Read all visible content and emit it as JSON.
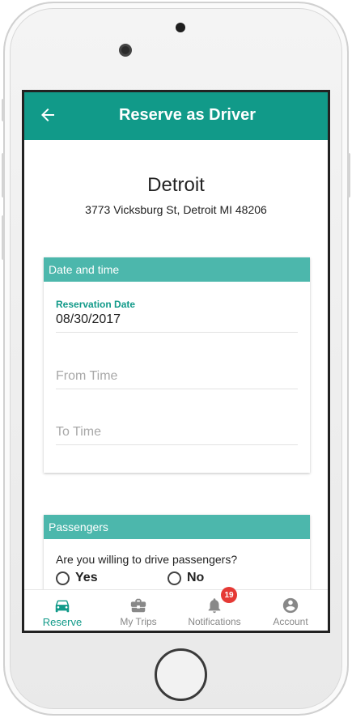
{
  "app_bar": {
    "title": "Reserve as Driver",
    "back_icon": "arrow-left-icon"
  },
  "location": {
    "name": "Detroit",
    "address": "3773 Vicksburg St, Detroit MI 48206"
  },
  "date_time_card": {
    "header": "Date and time",
    "reservation_date": {
      "label": "Reservation Date",
      "value": "08/30/2017"
    },
    "from_time": {
      "placeholder": "From Time"
    },
    "to_time": {
      "placeholder": "To Time"
    }
  },
  "passengers_card": {
    "header": "Passengers",
    "question": "Are you willing to drive passengers?",
    "options": [
      {
        "label": "Yes",
        "selected": false
      },
      {
        "label": "No",
        "selected": false
      }
    ]
  },
  "bottom_nav": {
    "items": [
      {
        "label": "Reserve",
        "icon": "car-icon",
        "active": true
      },
      {
        "label": "My Trips",
        "icon": "briefcase-icon",
        "active": false
      },
      {
        "label": "Notifications",
        "icon": "bell-icon",
        "active": false,
        "badge": "19"
      },
      {
        "label": "Account",
        "icon": "account-icon",
        "active": false
      }
    ]
  },
  "colors": {
    "primary": "#119a89",
    "card_header": "#4cb7ac",
    "badge": "#e53935",
    "inactive_nav": "#888888"
  }
}
